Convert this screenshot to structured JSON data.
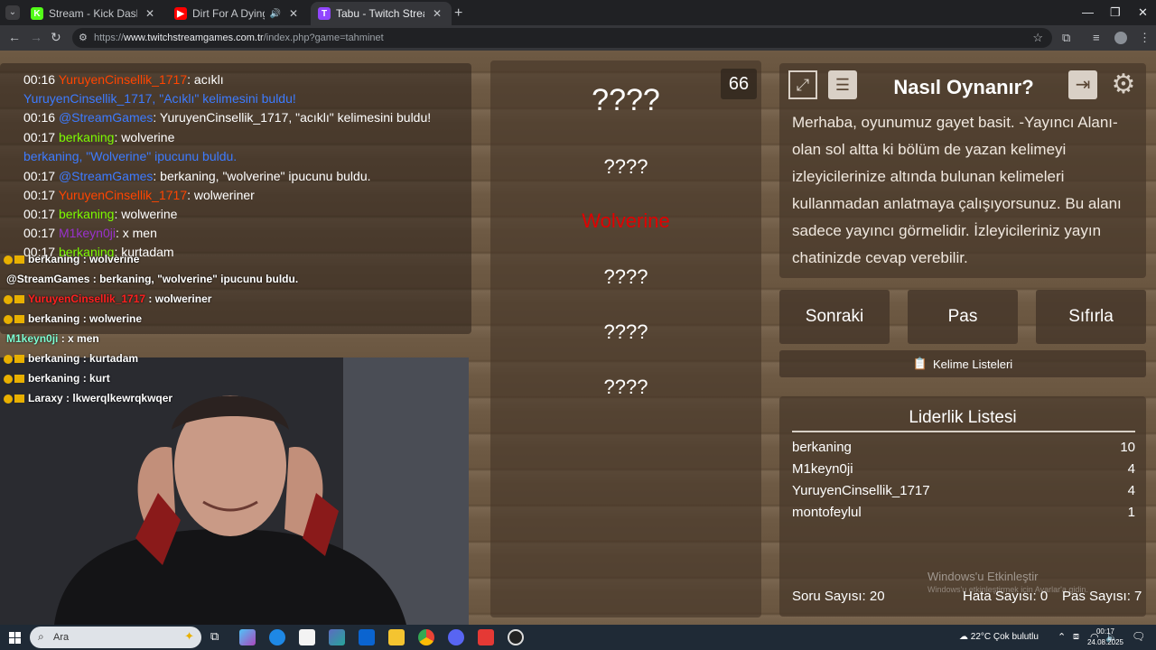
{
  "browser": {
    "tabs": [
      {
        "title": "Stream - Kick Dashboard",
        "icon": "K",
        "color": "#53fc18"
      },
      {
        "title": "Dirt For A Dying Sun - YouT",
        "icon": "▶",
        "color": "#ff0000"
      },
      {
        "title": "Tabu - Twitch Stream Games",
        "icon": "T",
        "color": "#9146ff"
      }
    ],
    "url_prefix": "https://",
    "url_host": "www.twitchstreamgames.com.tr",
    "url_path": "/index.php?game=tahminet"
  },
  "chat": {
    "lines": [
      {
        "time": "00:16",
        "user": "YuruyenCinsellik_1717",
        "user_color": "#ff4500",
        "text": ": acıklı"
      },
      {
        "time": "",
        "user": "YuruyenCinsellik_1717,",
        "user_color": "#3d7bff",
        "text": " \"Acıklı\" kelimesini buldu!",
        "text_color": "#3d7bff"
      },
      {
        "time": "00:16",
        "user": "@StreamGames",
        "user_color": "#3d7bff",
        "text": ": YuruyenCinsellik_1717, \"acıklı\" kelimesini buldu!"
      },
      {
        "time": "00:17",
        "user": "berkaning",
        "user_color": "#7cfc00",
        "text": ": wolverine"
      },
      {
        "time": "",
        "user": "berkaning,",
        "user_color": "#3d7bff",
        "text": " \"Wolverine\" ipucunu buldu.",
        "text_color": "#3d7bff"
      },
      {
        "time": "00:17",
        "user": "@StreamGames",
        "user_color": "#3d7bff",
        "text": ": berkaning, \"wolverine\" ipucunu buldu."
      },
      {
        "time": "00:17",
        "user": "YuruyenCinsellik_1717",
        "user_color": "#ff4500",
        "text": ": wolweriner"
      },
      {
        "time": "00:17",
        "user": "berkaning",
        "user_color": "#7cfc00",
        "text": ": wolwerine"
      },
      {
        "time": "00:17",
        "user": "M1keyn0ji",
        "user_color": "#9932cc",
        "text": ": x men"
      },
      {
        "time": "00:17",
        "user": "berkaning",
        "user_color": "#7cfc00",
        "text": ": kurtadam"
      }
    ]
  },
  "overlay_chat": [
    {
      "user": "berkaning",
      "user_color": "#ffffff",
      "text": " : wolverine",
      "badges": true
    },
    {
      "user": "@StreamGames",
      "user_color": "#ffffff",
      "text": " : berkaning, \"wolverine\" ipucunu buldu.",
      "badges": false
    },
    {
      "user": "YuruyenCinsellik_1717",
      "user_color": "#ff2020",
      "text": " : wolweriner",
      "badges": true
    },
    {
      "user": "berkaning",
      "user_color": "#ffffff",
      "text": " : wolwerine",
      "badges": true
    },
    {
      "user": "M1keyn0ji",
      "user_color": "#7fffd4",
      "text": " : x men",
      "badges": false
    },
    {
      "user": "berkaning",
      "user_color": "#ffffff",
      "text": " : kurtadam",
      "badges": true
    },
    {
      "user": "berkaning",
      "user_color": "#ffffff",
      "text": " : kurt",
      "badges": true
    },
    {
      "user": "Laraxy",
      "user_color": "#ffffff",
      "text": " : lkwerqlkewrqkwqer",
      "badges": true
    }
  ],
  "game": {
    "timer": "66",
    "words": [
      {
        "text": "????",
        "size": 34,
        "color": "#ffffff"
      },
      {
        "text": "????",
        "size": 22,
        "color": "#ffffff"
      },
      {
        "text": "Wolverine",
        "size": 22,
        "color": "#e00000"
      },
      {
        "text": "????",
        "size": 22,
        "color": "#ffffff"
      },
      {
        "text": "????",
        "size": 22,
        "color": "#ffffff"
      },
      {
        "text": "????",
        "size": 22,
        "color": "#ffffff"
      }
    ],
    "howto_title": "Nasıl Oynanır?",
    "howto_lines": [
      "Merhaba, oyunumuz gayet basit. -Yayıncı Alanı-",
      "olan sol altta ki bölüm de yazan kelimeyi",
      "izleyicilerinize altında bulunan kelimeleri",
      "kullanmadan anlatmaya çalışıyorsunuz. Bu alanı",
      "sadece yayıncı görmelidir. İzleyicileriniz yayın",
      "chatinizde cevap verebilir."
    ],
    "btn_next": "Sonraki",
    "btn_pass": "Pas",
    "btn_reset": "Sıfırla",
    "btn_wordlists": "Kelime Listeleri",
    "leaderboard_title": "Liderlik Listesi",
    "leaderboard": [
      {
        "name": "berkaning",
        "score": "10"
      },
      {
        "name": "M1keyn0ji",
        "score": "4"
      },
      {
        "name": "YuruyenCinsellik_1717",
        "score": "4"
      },
      {
        "name": "montofeylul",
        "score": "1"
      }
    ],
    "question_count_label": "Soru Sayısı: 20",
    "error_count_label": "Hata Sayısı: 0",
    "pass_count_label": "Pas Sayısı: 7",
    "watermark_title": "Windows'u Etkinleştir",
    "watermark_sub": "Windows'u etkinleştirmek için Ayarlar'a gidin."
  },
  "taskbar": {
    "search": "Ara",
    "weather": "22°C  Çok bulutlu",
    "time": "00:17",
    "date": "24.08.2025"
  }
}
